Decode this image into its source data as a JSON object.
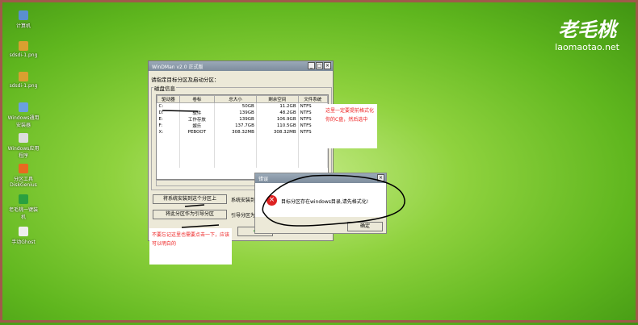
{
  "desktop": {
    "icons": [
      "计算机",
      "sdsdi-1.png",
      "sdsdi-1.png",
      "Windows通用安装器",
      "Windows应用程序",
      "分区工具DiskGenius",
      "老毛桃一键装机",
      "手动Ghost"
    ]
  },
  "logo": {
    "cn": "老毛桃",
    "en": "laomaotao.net"
  },
  "window": {
    "title": "WinDMan v2.0 正式版",
    "prompt": "请指定目标分区及启动分区：",
    "group": "磁盘信息",
    "columns": [
      "驱动器",
      "卷标",
      "总大小",
      "剩余空间",
      "文件系统"
    ],
    "rows": [
      [
        "C:",
        "",
        "50GB",
        "11.2GB",
        "NTFS"
      ],
      [
        "D:",
        "软件",
        "139GB",
        "48.2GB",
        "NTFS"
      ],
      [
        "E:",
        "工作存放",
        "139GB",
        "106.9GB",
        "NTFS"
      ],
      [
        "F:",
        "娱乐",
        "137.7GB",
        "110.5GB",
        "NTFS"
      ],
      [
        "X:",
        "PEBOOT",
        "308.32MB",
        "308.32MB",
        "NTFS"
      ]
    ],
    "install_button": "将系统安装到这个分区上",
    "boot_button": "将此分区作为引导分区",
    "install_label": "系统安装到",
    "boot_label": "引导分区为"
  },
  "notes": {
    "n1": "这里一定要提前格式化你的C盘，然后选中",
    "n2": "不要忘记这里也需要点击一下，应该可以明白的"
  },
  "dialog": {
    "title": "错误",
    "message": "目标分区存在windows目录,请先格式化!",
    "ok": "确定"
  }
}
